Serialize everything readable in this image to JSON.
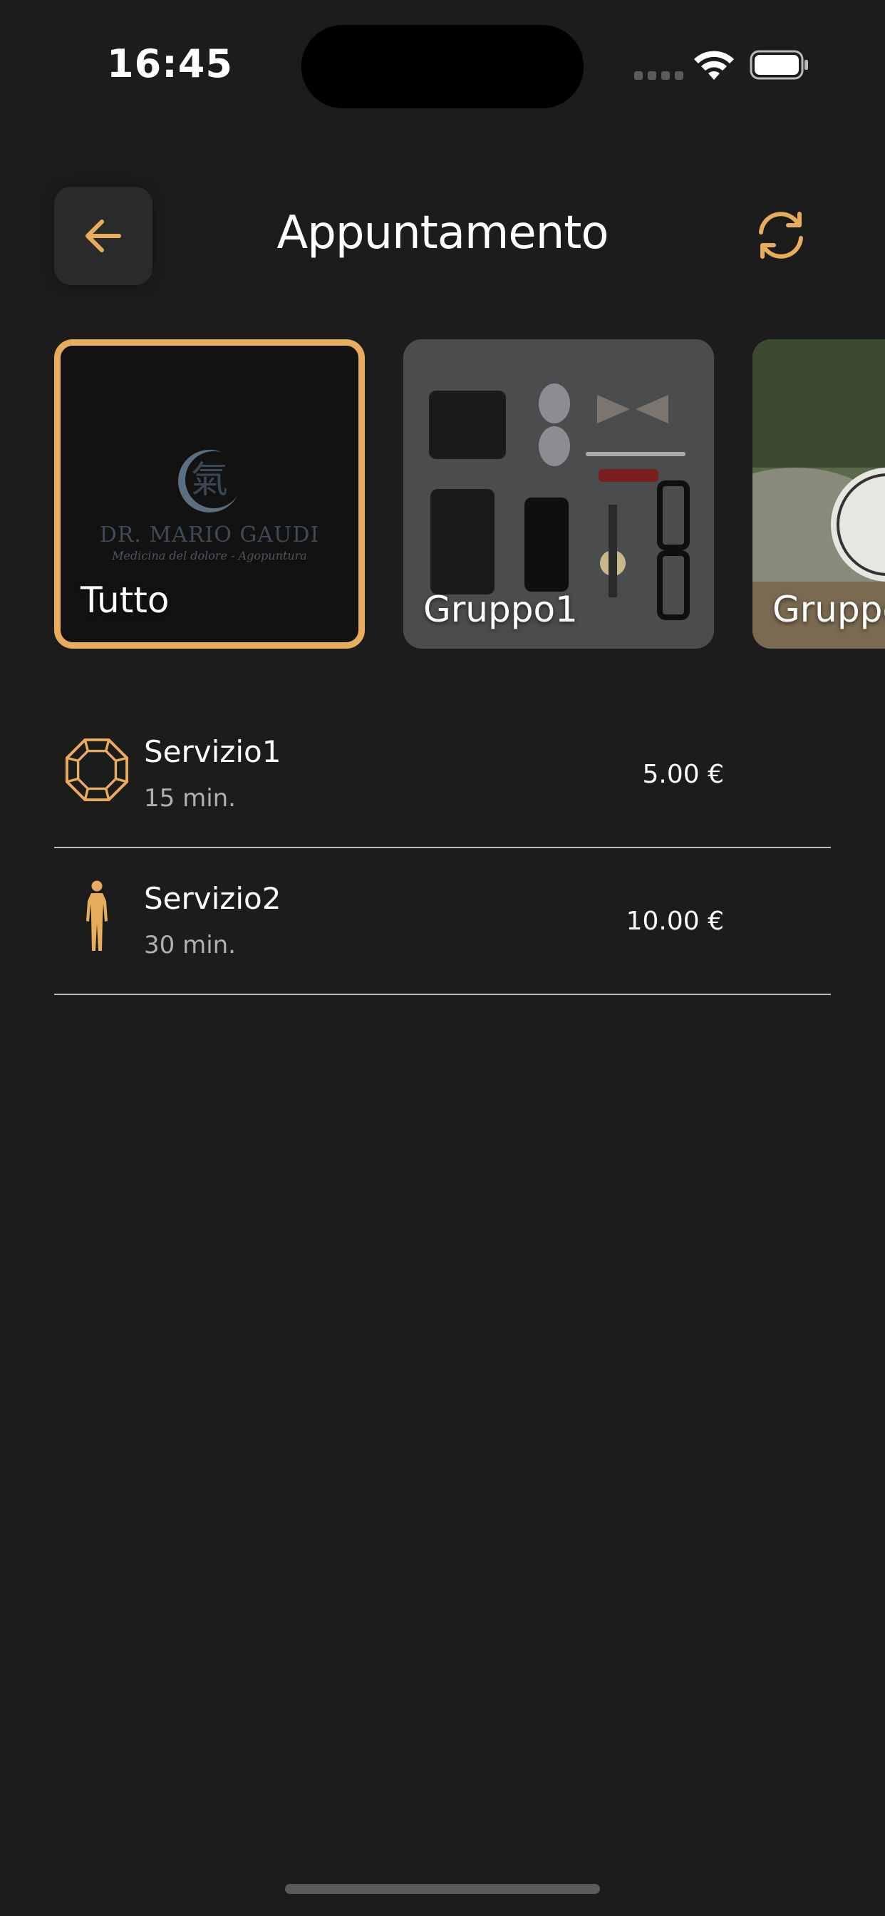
{
  "status_bar": {
    "time": "16:45"
  },
  "header": {
    "title": "Appuntamento",
    "back_icon": "arrow-left-icon",
    "refresh_icon": "refresh-icon"
  },
  "colors": {
    "accent": "#e8ad5c",
    "background": "#1c1c1d"
  },
  "groups": [
    {
      "label": "Tutto",
      "selected": true,
      "logo_name": "DR. MARIO GAUDI",
      "logo_subtitle": "Medicina del dolore - Agopuntura"
    },
    {
      "label": "Gruppo1",
      "selected": false
    },
    {
      "label": "Gruppo",
      "selected": false
    }
  ],
  "services": [
    {
      "name": "Servizio1",
      "duration": "15 min.",
      "price": "5.00 €",
      "icon": "octagon-gem-icon"
    },
    {
      "name": "Servizio2",
      "duration": "30 min.",
      "price": "10.00 €",
      "icon": "human-body-icon"
    }
  ]
}
